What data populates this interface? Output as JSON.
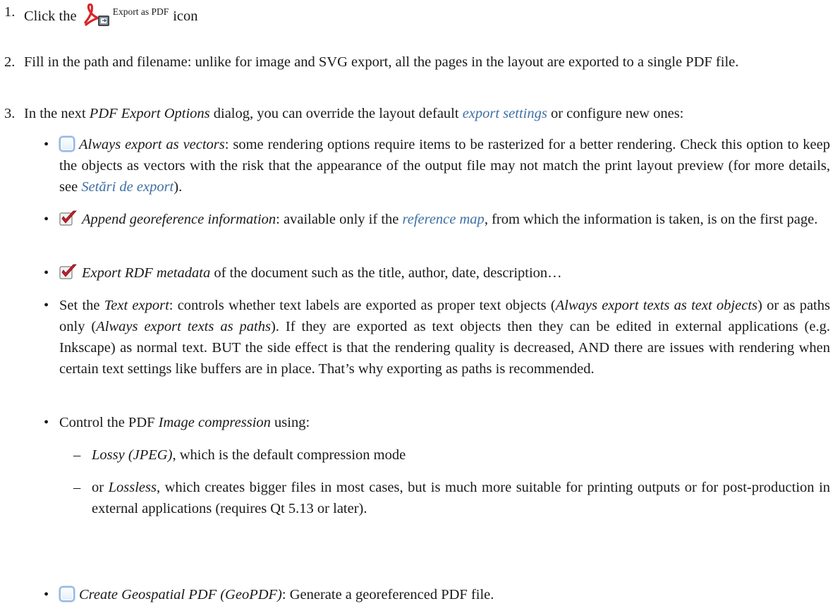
{
  "step1": {
    "num": "1.",
    "pre": "Click the",
    "icon_label": "Export as PDF",
    "post": "icon"
  },
  "step2": {
    "num": "2.",
    "text": "Fill in the path and filename: unlike for image and SVG export, all the pages in the layout are exported to a single PDF file."
  },
  "step3": {
    "num": "3.",
    "pre": "In the next",
    "dialog": "PDF Export Options",
    "mid": "dialog, you can override the layout default",
    "link": "export settings",
    "post": "or configure new ones:"
  },
  "options": {
    "vectors": {
      "checked": false,
      "label": "Always export as vectors",
      "text": ": some rendering options require items to be rasterized for a better rendering. Check this option to keep the objects as vectors with the risk that the appearance of the output file may not match the print layout preview (for more details, see",
      "link": "Setări de export",
      "end": ")."
    },
    "georef": {
      "checked": true,
      "label": "Append georeference information",
      "text": ": available only if the",
      "link": "reference map",
      "end": ", from which the information is taken, is on the first page."
    },
    "rdf": {
      "checked": true,
      "label": "Export RDF metadata",
      "text": "of the document such as the title, author, date, description…"
    },
    "text_export": {
      "pre": "Set the",
      "label": "Text export",
      "a": ": controls whether text labels are exported as proper text objects (",
      "opt1": "Always export texts as text objects",
      "b": ") or as paths only (",
      "opt2": "Always export texts as paths",
      "c": "). If they are exported as text objects then they can be edited in external applications (e.g. Inkscape) as normal text. BUT the side effect is that the rendering quality is decreased, AND there are issues with rendering when certain text settings like buffers are in place. That’s why exporting as paths is recommended."
    },
    "compression": {
      "pre": "Control the PDF",
      "label": "Image compression",
      "post": "using:",
      "lossy": {
        "label": "Lossy (JPEG)",
        "text": ", which is the default compression mode"
      },
      "lossless": {
        "pre": "or",
        "label": "Lossless",
        "text": ", which creates bigger files in most cases, but is much more suitable for printing outputs or for post-production in external applications (requires Qt 5.13 or later)."
      }
    },
    "geopdf": {
      "checked": false,
      "label": "Create Geospatial PDF (GeoPDF)",
      "text": ": Generate a georeferenced PDF file."
    }
  },
  "markers": {
    "bullet": "•",
    "dash": "–"
  },
  "colors": {
    "link": "#3f6fa4",
    "text": "#1a1a1a",
    "pdf_red": "#d8262b",
    "check_red": "#c81e2c"
  }
}
